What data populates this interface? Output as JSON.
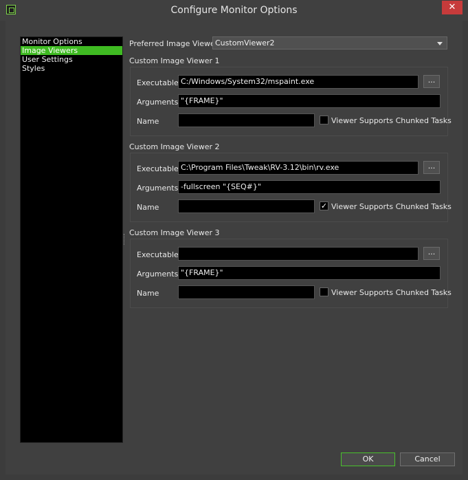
{
  "window": {
    "title": "Configure Monitor Options",
    "close_glyph": "✕"
  },
  "nav": {
    "items": [
      {
        "label": "Monitor Options",
        "selected": false
      },
      {
        "label": "Image Viewers",
        "selected": true
      },
      {
        "label": "User Settings",
        "selected": false
      },
      {
        "label": "Styles",
        "selected": false
      }
    ]
  },
  "preferred": {
    "label": "Preferred Image Viewer",
    "value": "CustomViewer2"
  },
  "viewers": [
    {
      "title": "Custom Image Viewer 1",
      "executable_label": "Executable",
      "executable": "C:/Windows/System32/mspaint.exe",
      "arguments_label": "Arguments",
      "arguments": "\"{FRAME}\"",
      "name_label": "Name",
      "name": "",
      "chunked_label": "Viewer Supports Chunked Tasks",
      "chunked": false,
      "browse_label": "..."
    },
    {
      "title": "Custom Image Viewer 2",
      "executable_label": "Executable",
      "executable": "C:\\Program Files\\Tweak\\RV-3.12\\bin\\rv.exe",
      "arguments_label": "Arguments",
      "arguments": "-fullscreen \"{SEQ#}\"",
      "name_label": "Name",
      "name": "",
      "chunked_label": "Viewer Supports Chunked Tasks",
      "chunked": true,
      "browse_label": "..."
    },
    {
      "title": "Custom Image Viewer 3",
      "executable_label": "Executable",
      "executable": "",
      "arguments_label": "Arguments",
      "arguments": "\"{FRAME}\"",
      "name_label": "Name",
      "name": "",
      "chunked_label": "Viewer Supports Chunked Tasks",
      "chunked": false,
      "browse_label": "..."
    }
  ],
  "buttons": {
    "ok": "OK",
    "cancel": "Cancel"
  },
  "colors": {
    "accent": "#3fba22",
    "background": "#3c3c3c",
    "field": "#000000",
    "close": "#c73b3b"
  }
}
